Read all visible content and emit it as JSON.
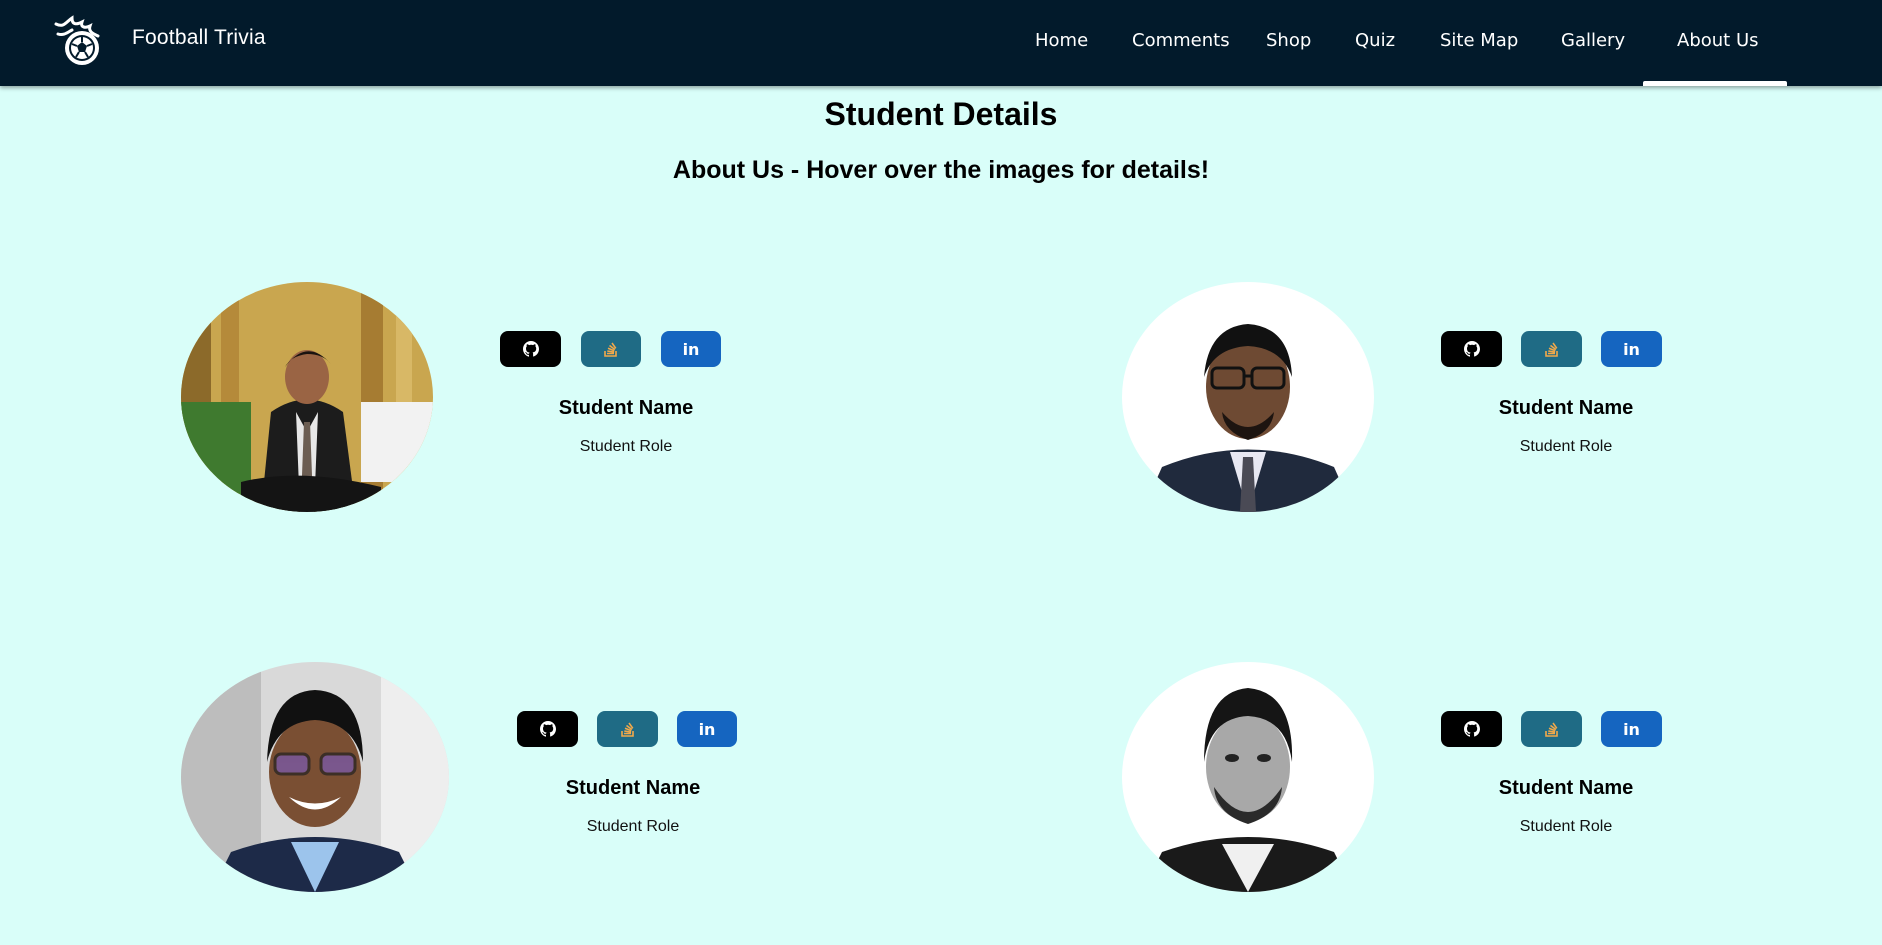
{
  "nav": {
    "brand": "Football Trivia",
    "links": [
      "Home",
      "Comments",
      "Shop",
      "Quiz",
      "Site Map",
      "Gallery",
      "About Us"
    ],
    "active": "About Us"
  },
  "page": {
    "title": "Student Details",
    "subtitle": "About Us - Hover over the images for details!"
  },
  "students": [
    {
      "name": "Student Name",
      "role": "Student Role"
    },
    {
      "name": "Student Name",
      "role": "Student Role"
    },
    {
      "name": "Student Name",
      "role": "Student Role"
    },
    {
      "name": "Student Name",
      "role": "Student Role"
    }
  ],
  "social": {
    "github": "github-icon",
    "stackoverflow": "stackoverflow-icon",
    "linkedin_label": "in"
  },
  "colors": {
    "nav_bg": "#021a2b",
    "page_bg": "#d9fef9",
    "github": "#000000",
    "stackoverflow": "#1f6b85",
    "linkedin": "#1565c0"
  }
}
